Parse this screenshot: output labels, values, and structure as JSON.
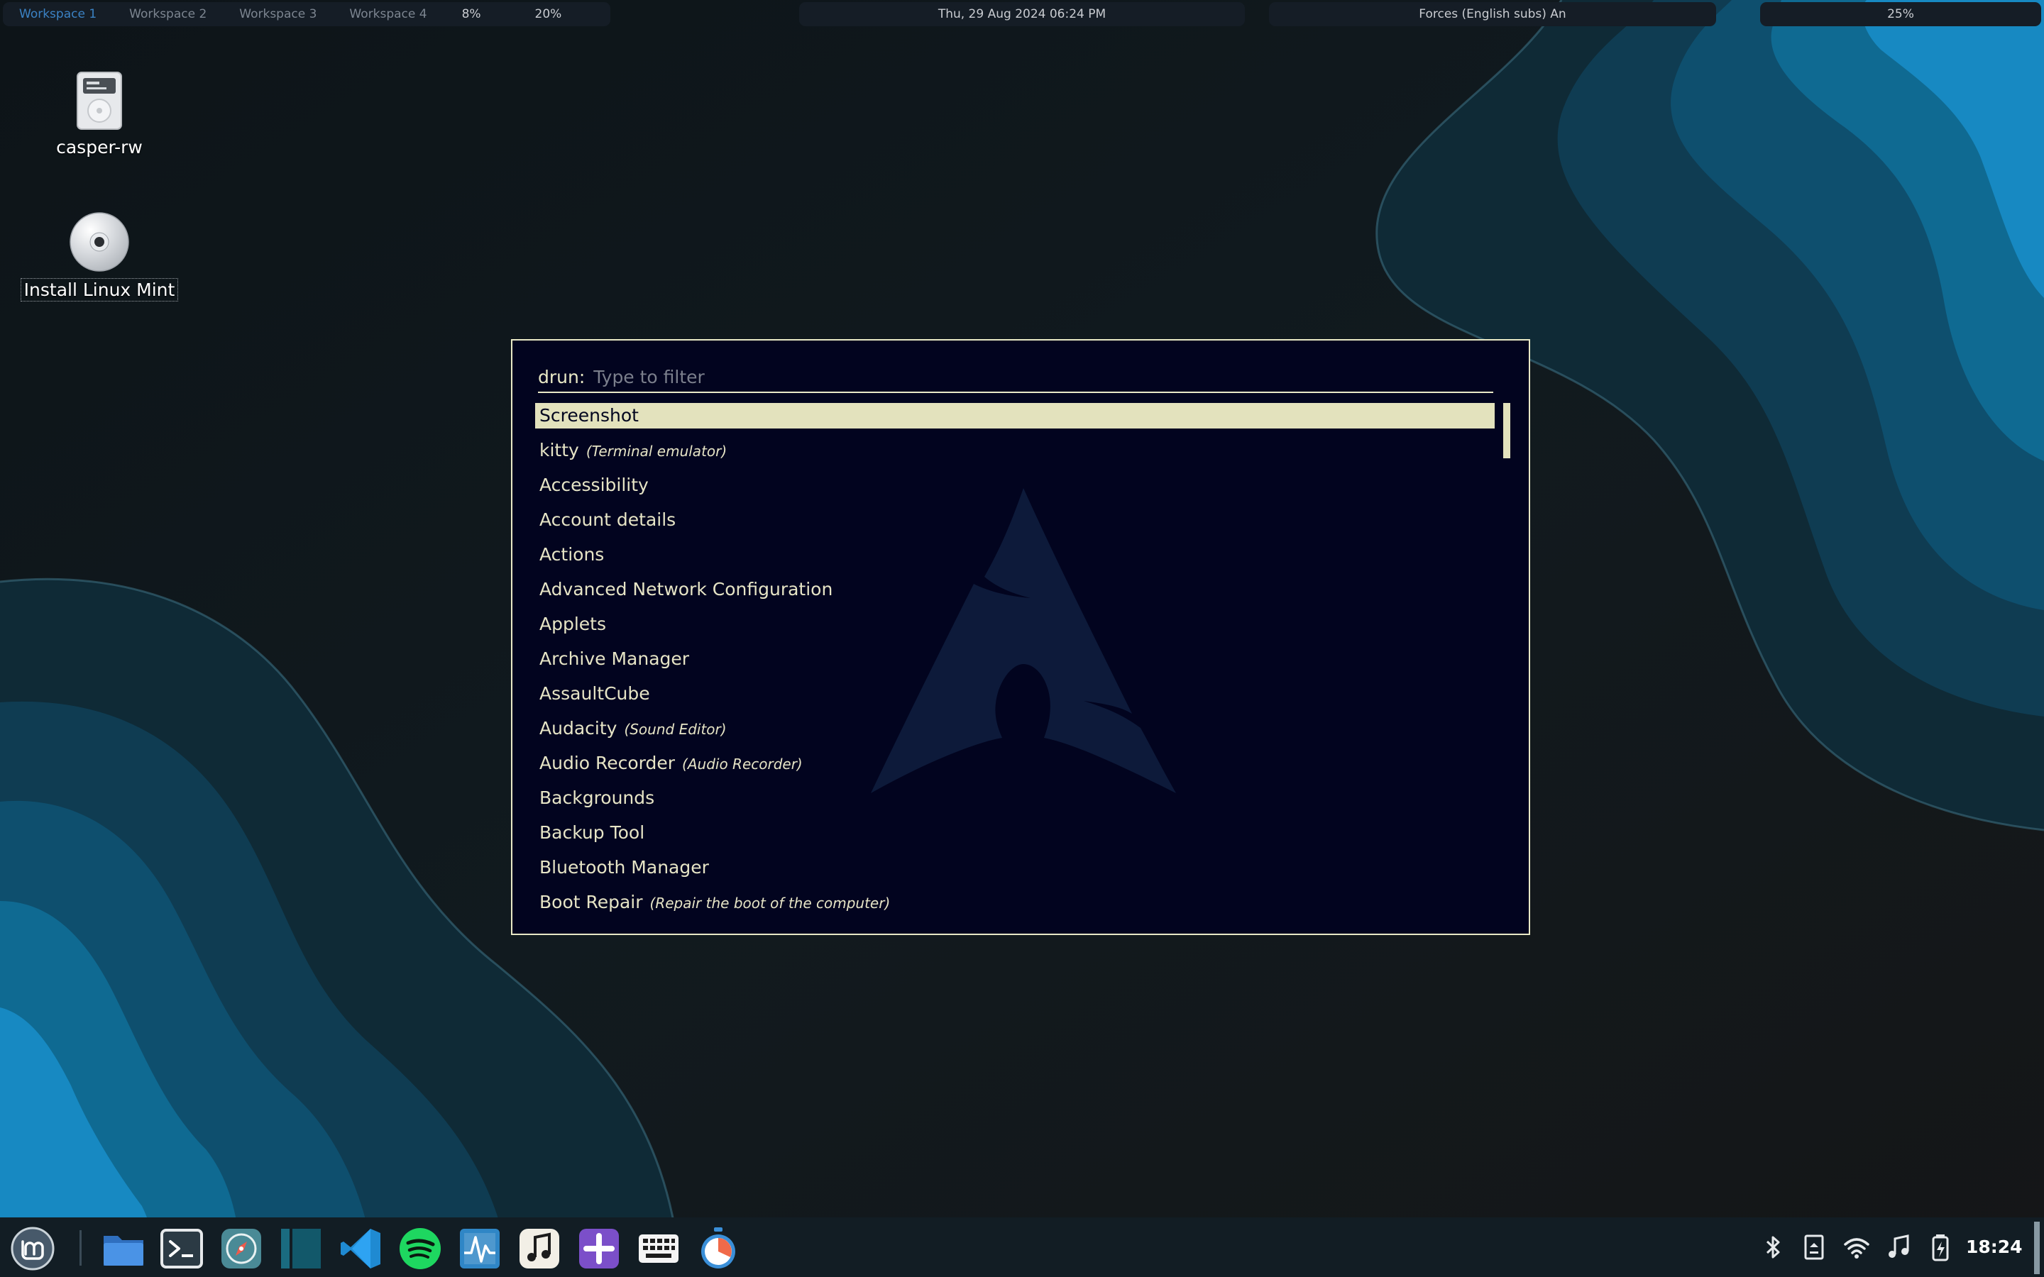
{
  "topbar": {
    "workspaces": [
      "Workspace 1",
      "Workspace 2",
      "Workspace 3",
      "Workspace 4"
    ],
    "active_workspace": 0,
    "cpu": "8%",
    "mem": "20%",
    "datetime": "Thu, 29 Aug 2024 06:24 PM",
    "media": "Forces (English subs) An",
    "volume": "25%"
  },
  "desktop": {
    "icons": [
      {
        "label": "casper-rw",
        "icon": "drive-icon"
      },
      {
        "label": "Install Linux Mint",
        "icon": "disc-icon"
      }
    ]
  },
  "launcher": {
    "prompt": "drun:",
    "placeholder": "Type to filter",
    "selected_index": 0,
    "entries": [
      {
        "name": "Screenshot",
        "sub": ""
      },
      {
        "name": "kitty",
        "sub": "(Terminal emulator)"
      },
      {
        "name": "Accessibility",
        "sub": ""
      },
      {
        "name": "Account details",
        "sub": ""
      },
      {
        "name": "Actions",
        "sub": ""
      },
      {
        "name": "Advanced Network Configuration",
        "sub": ""
      },
      {
        "name": "Applets",
        "sub": ""
      },
      {
        "name": "Archive Manager",
        "sub": ""
      },
      {
        "name": "AssaultCube",
        "sub": ""
      },
      {
        "name": "Audacity",
        "sub": "(Sound Editor)"
      },
      {
        "name": "Audio Recorder",
        "sub": "(Audio Recorder)"
      },
      {
        "name": "Backgrounds",
        "sub": ""
      },
      {
        "name": "Backup Tool",
        "sub": ""
      },
      {
        "name": "Bluetooth Manager",
        "sub": ""
      },
      {
        "name": "Boot Repair",
        "sub": "(Repair the boot of the computer)"
      }
    ]
  },
  "dock": {
    "apps": [
      "mint-menu-icon",
      "files-icon",
      "terminal-icon",
      "web-browser-icon",
      "panel-app-icon",
      "vscode-icon",
      "spotify-icon",
      "system-monitor-icon",
      "music-icon",
      "add-icon",
      "keyboard-icon",
      "timer-icon"
    ],
    "tray": [
      "bluetooth-icon",
      "notes-icon",
      "wifi-icon",
      "music-note-icon",
      "battery-icon"
    ],
    "clock": "18:24"
  },
  "colors": {
    "launcher_bg": "#02041f",
    "launcher_fg": "#e6e4c6",
    "launcher_selected_bg": "#e3e2bd",
    "active_workspace": "#3b82c4"
  }
}
